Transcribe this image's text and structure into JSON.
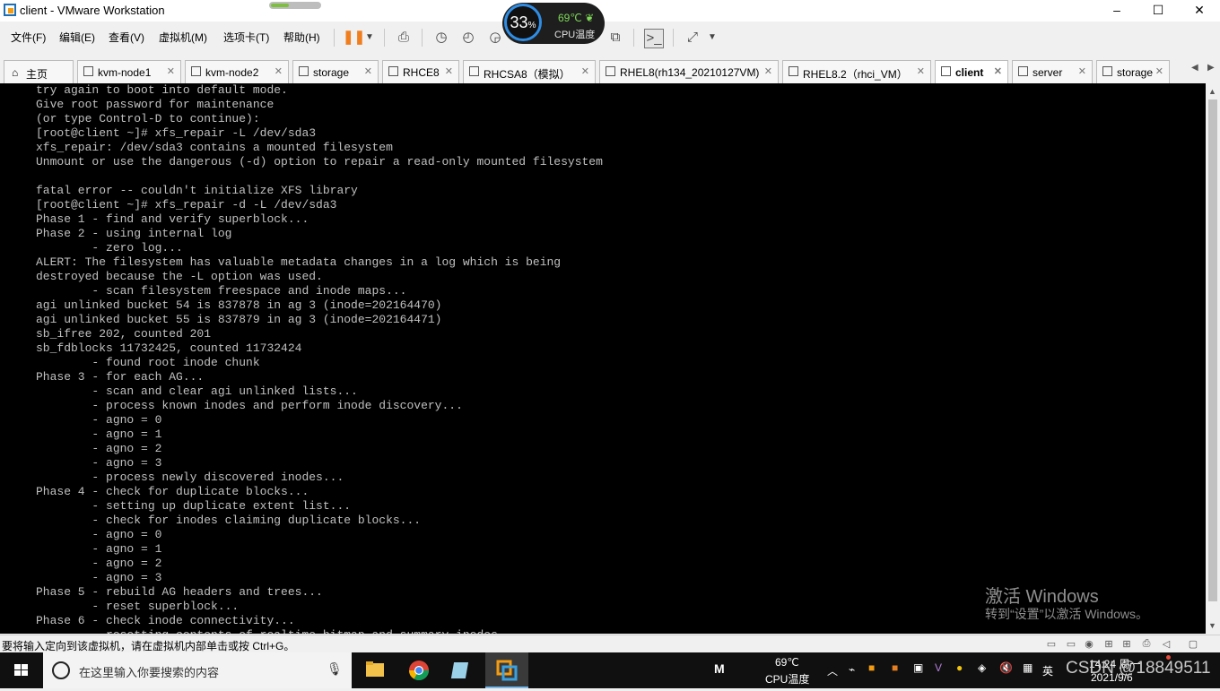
{
  "window": {
    "title": "client - VMware Workstation",
    "minimize": "–",
    "maximize": "☐",
    "close": "✕"
  },
  "menu": {
    "items": [
      "文件(F)",
      "编辑(E)",
      "查看(V)",
      "虚拟机(M)",
      "选项卡(T)",
      "帮助(H)"
    ]
  },
  "cpu_widget": {
    "percent": "33",
    "percent_sign": "%",
    "temp": "69℃",
    "label": "CPU温度"
  },
  "tabs": [
    {
      "label": "主页",
      "active": false
    },
    {
      "label": "kvm-node1",
      "active": false
    },
    {
      "label": "kvm-node2",
      "active": false
    },
    {
      "label": "storage",
      "active": false
    },
    {
      "label": "RHCE8",
      "active": false
    },
    {
      "label": "RHCSA8（模拟）",
      "active": false
    },
    {
      "label": "RHEL8(rh134_20210127VM)",
      "active": false
    },
    {
      "label": "RHEL8.2（rhci_VM）",
      "active": false
    },
    {
      "label": "client",
      "active": true
    },
    {
      "label": "server",
      "active": false
    },
    {
      "label": "storage",
      "active": false
    }
  ],
  "console": {
    "lines": [
      "try again to boot into default mode.",
      "Give root password for maintenance",
      "(or type Control-D to continue):",
      "[root@client ~]# xfs_repair -L /dev/sda3",
      "xfs_repair: /dev/sda3 contains a mounted filesystem",
      "Unmount or use the dangerous (-d) option to repair a read-only mounted filesystem",
      "",
      "fatal error -- couldn't initialize XFS library",
      "[root@client ~]# xfs_repair -d -L /dev/sda3",
      "Phase 1 - find and verify superblock...",
      "Phase 2 - using internal log",
      "        - zero log...",
      "ALERT: The filesystem has valuable metadata changes in a log which is being",
      "destroyed because the -L option was used.",
      "        - scan filesystem freespace and inode maps...",
      "agi unlinked bucket 54 is 837878 in ag 3 (inode=202164470)",
      "agi unlinked bucket 55 is 837879 in ag 3 (inode=202164471)",
      "sb_ifree 202, counted 201",
      "sb_fdblocks 11732425, counted 11732424",
      "        - found root inode chunk",
      "Phase 3 - for each AG...",
      "        - scan and clear agi unlinked lists...",
      "        - process known inodes and perform inode discovery...",
      "        - agno = 0",
      "        - agno = 1",
      "        - agno = 2",
      "        - agno = 3",
      "        - process newly discovered inodes...",
      "Phase 4 - check for duplicate blocks...",
      "        - setting up duplicate extent list...",
      "        - check for inodes claiming duplicate blocks...",
      "        - agno = 0",
      "        - agno = 1",
      "        - agno = 2",
      "        - agno = 3",
      "Phase 5 - rebuild AG headers and trees...",
      "        - reset superblock...",
      "Phase 6 - check inode connectivity...",
      "        - resetting contents of realtime bitmap and summary inodes"
    ]
  },
  "watermark": {
    "line1": "激活 Windows",
    "line2": "转到“设置”以激活 Windows。"
  },
  "statusbar": {
    "text": "要将输入定向到该虚拟机，请在虚拟机内部单击或按 Ctrl+G。"
  },
  "taskbar": {
    "search_placeholder": "在这里输入你要搜索的内容",
    "cpu_temp": "69℃",
    "cpu_label": "CPU温度",
    "ime": "英",
    "ime_m": "M",
    "time": "14:24 周一",
    "date": "2021/9/6",
    "overlay_text": "CSDN @18849511"
  }
}
